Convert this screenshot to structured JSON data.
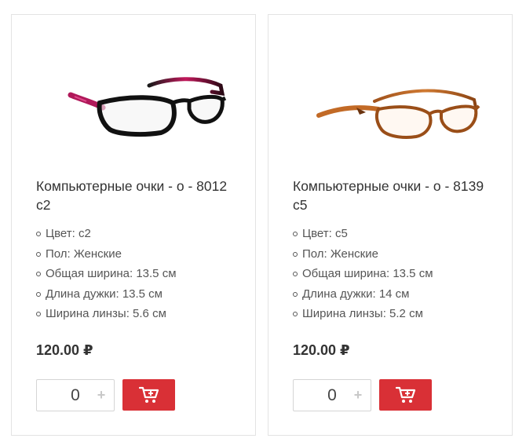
{
  "colors": {
    "accent": "#d93036",
    "border": "#e3e3e3",
    "text": "#333333"
  },
  "products": [
    {
      "title": "Компьютерные очки - о - 8012 с2",
      "specs": [
        "Цвет: с2",
        "Пол: Женские",
        "Общая ширина: 13.5 см",
        "Длина дужки: 13.5 см",
        "Ширина линзы: 5.6 см"
      ],
      "price": "120.00 ₽",
      "quantity": "0",
      "plus": "+",
      "cart_icon": "shopping-cart-icon"
    },
    {
      "title": "Компьютерные очки - о - 8139 с5",
      "specs": [
        "Цвет: с5",
        "Пол: Женские",
        "Общая ширина: 13.5 см",
        "Длина дужки: 14 см",
        "Ширина линзы: 5.2 см"
      ],
      "price": "120.00 ₽",
      "quantity": "0",
      "plus": "+",
      "cart_icon": "shopping-cart-icon"
    }
  ]
}
